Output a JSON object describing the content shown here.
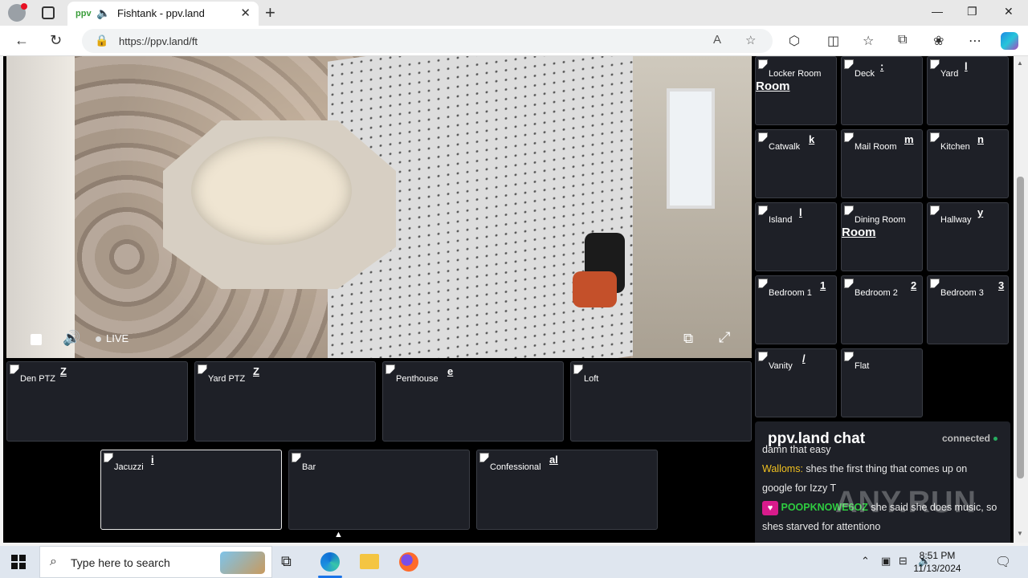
{
  "browser": {
    "tab_title": "Fishtank - ppv.land",
    "tab_favicon": "ppv",
    "url": "https://ppv.land/ft"
  },
  "player": {
    "live_label": "LIVE"
  },
  "bottom_cams": [
    {
      "name": "Den PTZ",
      "frag": "Z"
    },
    {
      "name": "Yard PTZ",
      "frag": "Z"
    },
    {
      "name": "Penthouse",
      "frag": "e"
    },
    {
      "name": "Loft",
      "frag": ""
    },
    {
      "name": "Jacuzzi",
      "frag": "i"
    },
    {
      "name": "Bar",
      "frag": ""
    },
    {
      "name": "Confessional",
      "frag": "al"
    }
  ],
  "side_cams": [
    {
      "name": "Locker Room",
      "frag": "",
      "big": "Room"
    },
    {
      "name": "Deck",
      "frag": ":",
      "big": ""
    },
    {
      "name": "Yard",
      "frag": "l",
      "big": ""
    },
    {
      "name": "Catwalk",
      "frag": "k",
      "big": ""
    },
    {
      "name": "Mail Room",
      "frag": "m",
      "big": ""
    },
    {
      "name": "Kitchen",
      "frag": "n",
      "big": ""
    },
    {
      "name": "Island",
      "frag": "l",
      "big": ""
    },
    {
      "name": "Dining Room",
      "frag": "",
      "big": "Room"
    },
    {
      "name": "Hallway",
      "frag": "y",
      "big": ""
    },
    {
      "name": "Bedroom 1",
      "frag": "1",
      "big": ""
    },
    {
      "name": "Bedroom 2",
      "frag": "2",
      "big": ""
    },
    {
      "name": "Bedroom 3",
      "frag": "3",
      "big": ""
    },
    {
      "name": "Vanity",
      "frag": "/",
      "big": ""
    },
    {
      "name": "Flat",
      "frag": "",
      "big": ""
    }
  ],
  "chat": {
    "title": "ppv.land chat",
    "status": "connected",
    "messages": [
      {
        "user": "",
        "text": "damn that easy"
      },
      {
        "user": "Walloms:",
        "text": "shes the first thing that comes up on"
      },
      {
        "user": "",
        "text": "google for Izzy T"
      },
      {
        "user": "POOPKNOWE6OZ",
        "text": "she said she does music, so"
      },
      {
        "user": "",
        "text": "shes starved for attentiono"
      }
    ],
    "watermark": "ANY.RUN"
  },
  "taskbar": {
    "search_placeholder": "Type here to search",
    "time": "8:51 PM",
    "date": "11/13/2024"
  }
}
